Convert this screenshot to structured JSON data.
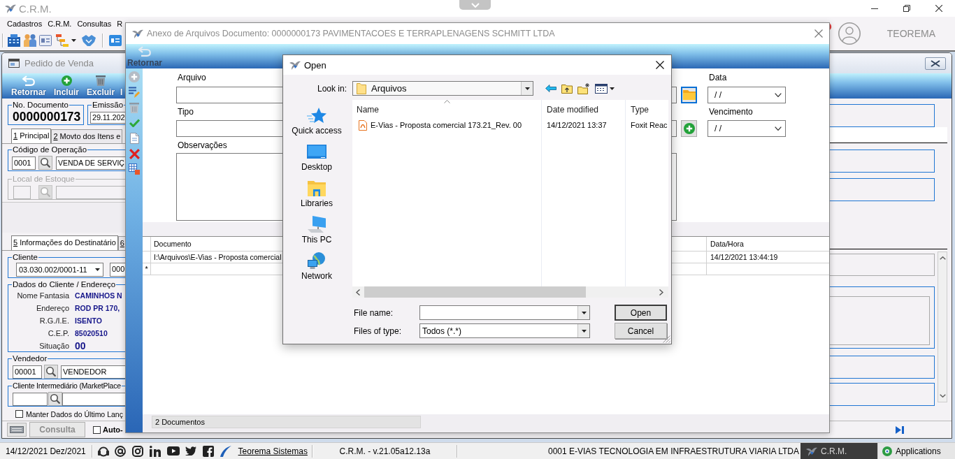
{
  "app_window": {
    "title": "C.R.M."
  },
  "menu_bar": {
    "items": [
      "Cadastros",
      "C.R.M.",
      "Consultas",
      "R"
    ]
  },
  "user": {
    "name": "TEOREMA"
  },
  "pedido_window": {
    "title": "Pedido de Venda",
    "toolbar": [
      {
        "label": "Retornar"
      },
      {
        "label": "Incluir"
      },
      {
        "label": "Excluir"
      },
      {
        "label": "I"
      }
    ],
    "documento": {
      "label": "No. Documento",
      "value": "0000000173"
    },
    "emissao": {
      "label": "Emissão",
      "value": "29.11.202"
    },
    "tabs": [
      {
        "key": "1",
        "label": "Principal",
        "selected": true
      },
      {
        "key": "2",
        "label": "Movto dos Itens e",
        "selected": false
      }
    ],
    "codigo_operacao": {
      "label": "Código de Operação",
      "code": "0001",
      "description": "VENDA DE SERVIÇ"
    },
    "local_estoque": {
      "label": "Local de Estoque",
      "disabled": true
    },
    "tabs_destinatario": [
      {
        "key": "5",
        "label": "Informações do Destinatário",
        "selected": true
      },
      {
        "key": "6",
        "selected": false
      }
    ],
    "cliente": {
      "label": "Cliente",
      "document": "03.030.002/0001-11",
      "code": "000"
    },
    "dados_cliente": {
      "label": "Dados do Cliente / Endereço",
      "fields": [
        {
          "label": "Nome Fantasia",
          "value": "CAMINHOS N",
          "kind": "text"
        },
        {
          "label": "Endereço",
          "value": "ROD PR 170,",
          "kind": "text"
        },
        {
          "label": "R.G./I.E.",
          "value": "ISENTO",
          "kind": "text"
        },
        {
          "label": "C.E.P.",
          "value": "85020510",
          "kind": "text"
        },
        {
          "label": "Situação",
          "value": "00",
          "kind": "status"
        }
      ]
    },
    "vendedor": {
      "label": "Vendedor",
      "code": "00001",
      "name": "VENDEDOR"
    },
    "cliente_intermediario": {
      "label": "Cliente Intermediário (MarketPlace"
    },
    "manter_dados": {
      "label": "Manter Dados do Último Lanç",
      "checked": false
    },
    "consulta": {
      "label": "Consulta",
      "disabled": true
    },
    "auto_gerar": {
      "label": "Auto-",
      "checked": false
    }
  },
  "anexo_dialog": {
    "title": "Anexo de Arquivos Documento: 0000000173 PAVIMENTACOES E TERRAPLENAGENS SCHMITT LTDA",
    "toolbar": [
      {
        "label": "Retornar",
        "disabled": true
      }
    ],
    "side_tools": [
      {
        "disabled": true
      },
      {
        "disabled": false
      },
      {
        "disabled": true
      },
      {
        "disabled": false
      },
      {
        "disabled": false
      },
      {
        "disabled": false
      },
      {
        "disabled": false
      }
    ],
    "fields": {
      "arquivo": {
        "label": "Arquivo"
      },
      "tipo": {
        "label": "Tipo"
      },
      "observacoes": {
        "label": "Observações"
      },
      "data": {
        "label": "Data",
        "value": "/ /"
      },
      "vencimento": {
        "label": "Vencimento",
        "value": "/ /"
      }
    },
    "grid": {
      "columns": [
        "Documento",
        "Data/Hora"
      ],
      "rows": [
        {
          "documento": "I:\\Arquivos\\E-Vias - Proposta comercial",
          "data_hora": "14/12/2021 13:44:19"
        }
      ],
      "new_row": {
        "marker": "*"
      }
    },
    "status": "2 Documentos"
  },
  "open_dialog": {
    "title": "Open",
    "look_in": {
      "label": "Look in:",
      "value": "Arquivos"
    },
    "places": [
      {
        "label": "Quick access"
      },
      {
        "label": "Desktop"
      },
      {
        "label": "Libraries"
      },
      {
        "label": "This PC"
      },
      {
        "label": "Network"
      }
    ],
    "columns": [
      {
        "label": "Name",
        "sorted": true
      },
      {
        "label": "Date modified",
        "sorted": false
      },
      {
        "label": "Type",
        "sorted": false
      }
    ],
    "files": [
      {
        "name": "E-Vias - Proposta comercial 173.21_Rev. 00",
        "date_modified": "14/12/2021 13:37",
        "type": "Foxit Reac"
      }
    ],
    "file_name": {
      "label": "File name:"
    },
    "files_of_type": {
      "label": "Files of type:",
      "value": "Todos (*.*)"
    },
    "buttons": [
      {
        "label": "Open",
        "default": true
      },
      {
        "label": "Cancel",
        "default": false
      }
    ]
  },
  "status_bar": {
    "date": "14/12/2021 Dez/2021",
    "link": "Teorema Sistemas",
    "version": "C.R.M. - v.21.05a12.13a",
    "company": "0001 E-VIAS TECNOLOGIA EM INFRAESTRUTURA VIARIA LTDA",
    "tasks": [
      {
        "label": "C.R.M.",
        "selected": true
      },
      {
        "label": "Applications",
        "selected": false
      }
    ]
  }
}
